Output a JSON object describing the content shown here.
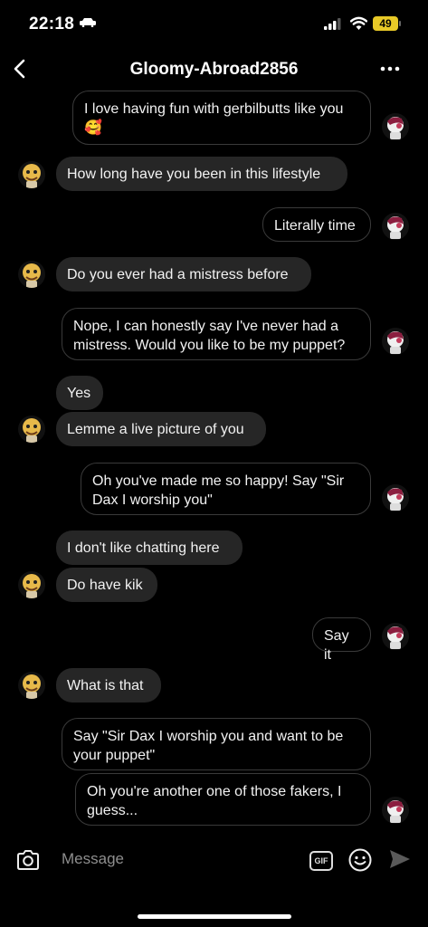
{
  "status": {
    "time": "22:18",
    "battery": "49"
  },
  "header": {
    "title": "Gloomy-Abroad2856",
    "back_icon": "chevron-left-icon",
    "more_icon": "ellipsis-icon"
  },
  "messages": [
    {
      "from": "me",
      "text": "I love having fun with gerbilbutts like you 🥰"
    },
    {
      "from": "them",
      "text": "How long have you been in this lifestyle"
    },
    {
      "from": "me",
      "text": "Literally time"
    },
    {
      "from": "them",
      "text": "Do you ever had a mistress before"
    },
    {
      "from": "me",
      "text": "Nope, I can honestly say I've never had a mistress. Would you like to be my puppet?"
    },
    {
      "from": "them",
      "text": "Yes"
    },
    {
      "from": "them",
      "text": "Lemme a live picture of you"
    },
    {
      "from": "me",
      "text": "Oh you've made me so happy! Say \"Sir Dax I worship you\""
    },
    {
      "from": "them",
      "text": "I don't like chatting here"
    },
    {
      "from": "them",
      "text": "Do have kik"
    },
    {
      "from": "me",
      "text": "Say it"
    },
    {
      "from": "them",
      "text": "What is that"
    },
    {
      "from": "me",
      "text": "Say \"Sir Dax I worship you and want to be your puppet\""
    },
    {
      "from": "me",
      "text": "Oh you're another one of those fakers, I guess..."
    }
  ],
  "composer": {
    "placeholder": "Message",
    "gif_label": "GIF"
  }
}
